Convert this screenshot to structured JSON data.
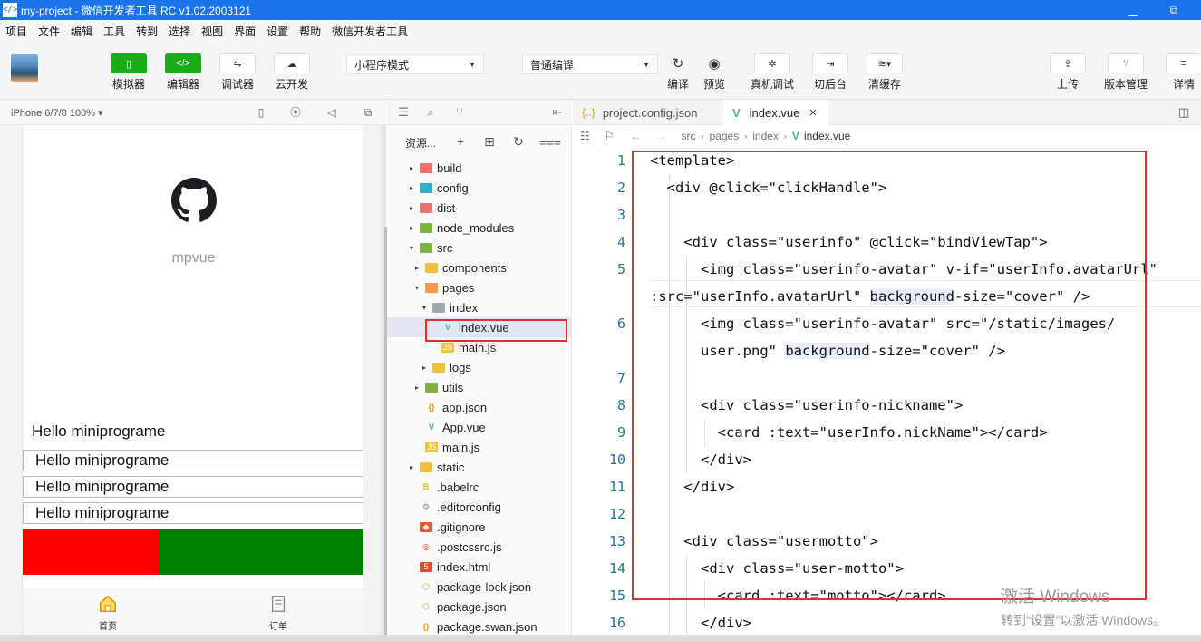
{
  "window": {
    "title": "my-project - 微信开发者工具 RC v1.02.2003121",
    "app_icon": "</>",
    "minimize": "▁",
    "restore": "⧉"
  },
  "menu": [
    "项目",
    "文件",
    "编辑",
    "工具",
    "转到",
    "选择",
    "视图",
    "界面",
    "设置",
    "帮助",
    "微信开发者工具"
  ],
  "toolbar": {
    "simulator": "模拟器",
    "editor": "编辑器",
    "debugger": "调试器",
    "cloud": "云开发",
    "mode_select": "小程序模式",
    "compile_select": "普通编译",
    "compile": "编译",
    "preview": "预览",
    "remote_debug": "真机调试",
    "background": "切后台",
    "clear_cache": "清缓存",
    "upload": "上传",
    "version": "版本管理",
    "details": "详情"
  },
  "simulator": {
    "device": "iPhone 6/7/8 100% ▾",
    "app_name": "mpvue",
    "hello_plain": "Hello miniprograme",
    "hello_cards": [
      "Hello miniprograme",
      "Hello miniprograme",
      "Hello miniprograme"
    ],
    "tabs": [
      "首页",
      "订单"
    ],
    "colors": {
      "red": "#ff0000",
      "green": "#008000"
    }
  },
  "explorer": {
    "title": "资源...",
    "tree": [
      {
        "label": "build",
        "arrow": "▸",
        "icon": "folder-red"
      },
      {
        "label": "config",
        "arrow": "▸",
        "icon": "folder-teal"
      },
      {
        "label": "dist",
        "arrow": "▸",
        "icon": "folder-red"
      },
      {
        "label": "node_modules",
        "arrow": "▸",
        "icon": "folder-green"
      },
      {
        "label": "src",
        "arrow": "▾",
        "icon": "folder-green"
      },
      {
        "label": "components",
        "arrow": "▸",
        "icon": "folder-yellow"
      },
      {
        "label": "pages",
        "arrow": "▾",
        "icon": "folder-orange"
      },
      {
        "label": "index",
        "arrow": "▾",
        "icon": "folder-gray"
      },
      {
        "label": "index.vue",
        "arrow": "",
        "icon": "vue"
      },
      {
        "label": "main.js",
        "arrow": "",
        "icon": "js"
      },
      {
        "label": "logs",
        "arrow": "▸",
        "icon": "folder-yellow"
      },
      {
        "label": "utils",
        "arrow": "▸",
        "icon": "folder-green"
      },
      {
        "label": "app.json",
        "arrow": "",
        "icon": "json"
      },
      {
        "label": "App.vue",
        "arrow": "",
        "icon": "vue"
      },
      {
        "label": "main.js",
        "arrow": "",
        "icon": "js"
      },
      {
        "label": "static",
        "arrow": "▸",
        "icon": "folder-yellow"
      },
      {
        "label": ".babelrc",
        "arrow": "",
        "icon": "babel"
      },
      {
        "label": ".editorconfig",
        "arrow": "",
        "icon": "editorconfig"
      },
      {
        "label": ".gitignore",
        "arrow": "",
        "icon": "git"
      },
      {
        "label": ".postcssrc.js",
        "arrow": "",
        "icon": "postcss"
      },
      {
        "label": "index.html",
        "arrow": "",
        "icon": "html"
      },
      {
        "label": "package-lock.json",
        "arrow": "",
        "icon": "npm"
      },
      {
        "label": "package.json",
        "arrow": "",
        "icon": "npm"
      },
      {
        "label": "package.swan.json",
        "arrow": "",
        "icon": "json"
      }
    ]
  },
  "editor": {
    "tabs": [
      "project.config.json",
      "index.vue"
    ],
    "close": "✕",
    "breadcrumb": [
      "src",
      "pages",
      "index",
      "index.vue"
    ],
    "lines": [
      {
        "n": "1",
        "text": "<template>"
      },
      {
        "n": "2",
        "text": "  <div @click=\"clickHandle\">"
      },
      {
        "n": "3",
        "text": ""
      },
      {
        "n": "4",
        "text": "    <div class=\"userinfo\" @click=\"bindViewTap\">"
      },
      {
        "n": "5",
        "text": "      <img class=\"userinfo-avatar\" v-if=\"userInfo.avatarUrl\""
      },
      {
        "n": "",
        "text": ":src=\"userInfo.avatarUrl\" background-size=\"cover\" />"
      },
      {
        "n": "6",
        "text": "      <img class=\"userinfo-avatar\" src=\"/static/images/"
      },
      {
        "n": "",
        "text": "      user.png\" background-size=\"cover\" />"
      },
      {
        "n": "7",
        "text": ""
      },
      {
        "n": "8",
        "text": "      <div class=\"userinfo-nickname\">"
      },
      {
        "n": "9",
        "text": "        <card :text=\"userInfo.nickName\"></card>"
      },
      {
        "n": "10",
        "text": "      </div>"
      },
      {
        "n": "11",
        "text": "    </div>"
      },
      {
        "n": "12",
        "text": ""
      },
      {
        "n": "13",
        "text": "    <div class=\"usermotto\">"
      },
      {
        "n": "14",
        "text": "      <div class=\"user-motto\">"
      },
      {
        "n": "15",
        "text": "        <card :text=\"motto\"></card>"
      },
      {
        "n": "16",
        "text": "      </div>"
      }
    ]
  },
  "watermark": {
    "line1": "激活 Windows",
    "line2": "转到“设置”以激活 Windows。"
  }
}
